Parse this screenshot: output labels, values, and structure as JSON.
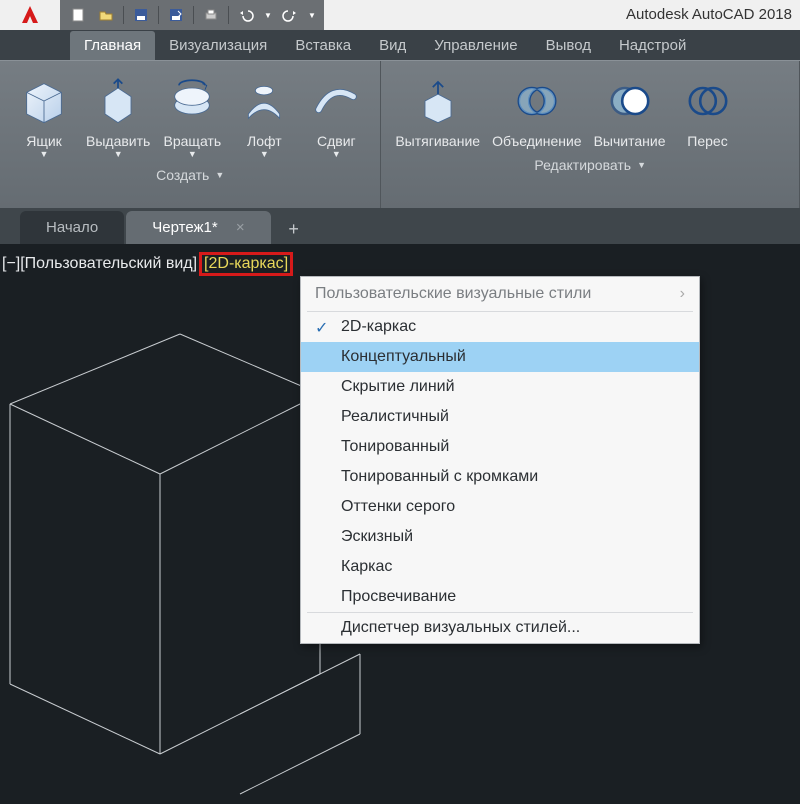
{
  "app": {
    "title": "Autodesk AutoCAD 2018"
  },
  "ribbon": {
    "tabs": [
      "Главная",
      "Визуализация",
      "Вставка",
      "Вид",
      "Управление",
      "Вывод",
      "Надстрой"
    ],
    "active_tab": 0,
    "group_create": {
      "title": "Создать",
      "items": [
        "Ящик",
        "Выдавить",
        "Вращать",
        "Лофт",
        "Сдвиг"
      ]
    },
    "group_edit": {
      "title": "Редактировать",
      "items": [
        "Вытягивание",
        "Объединение",
        "Вычитание",
        "Перес"
      ]
    }
  },
  "doctabs": {
    "items": [
      "Начало",
      "Чертеж1*"
    ],
    "active": 1
  },
  "viewport": {
    "minus": "[−]",
    "view_label": "[Пользовательский вид]",
    "style_label_open": "[",
    "style_label": "2D-каркас",
    "style_label_close": "]"
  },
  "context_menu": {
    "header": "Пользовательские визуальные стили",
    "checked_index": 0,
    "selected_index": 1,
    "items": [
      "2D-каркас",
      "Концептуальный",
      "Скрытие линий",
      "Реалистичный",
      "Тонированный",
      "Тонированный с кромками",
      "Оттенки серого",
      "Эскизный",
      "Каркас",
      "Просвечивание"
    ],
    "footer": "Диспетчер визуальных стилей..."
  }
}
